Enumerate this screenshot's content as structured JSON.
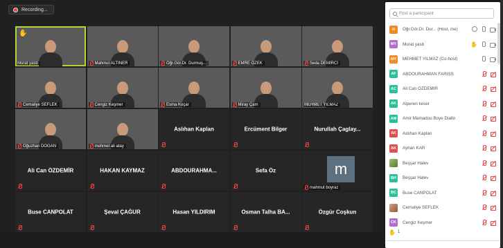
{
  "recording": {
    "label": "Recording..."
  },
  "gallery": {
    "tiles": [
      {
        "name": "Murat yasb",
        "kind": "video",
        "bg": "bg1",
        "hand": true,
        "muted": false,
        "active": true
      },
      {
        "name": "Mahmut ALTINER",
        "kind": "video",
        "bg": "bg2",
        "muted": true
      },
      {
        "name": "Öğr.Gör.Dr. Durmuş...",
        "kind": "video",
        "bg": "bg3",
        "muted": true
      },
      {
        "name": "EMRE ÖZEK",
        "kind": "video",
        "bg": "bg4",
        "muted": true
      },
      {
        "name": "Seda DEMİRCİ",
        "kind": "video",
        "bg": "bg5",
        "muted": true
      },
      {
        "name": "Cemaliye SEFLEK",
        "kind": "video",
        "bg": "bg6",
        "muted": true
      },
      {
        "name": "Cengiz Keşmer",
        "kind": "video",
        "bg": "bg7",
        "muted": true
      },
      {
        "name": "Esma Koçar",
        "kind": "video",
        "bg": "bg8",
        "muted": true
      },
      {
        "name": "Miray Çam",
        "kind": "video",
        "bg": "bg9",
        "muted": true
      },
      {
        "name": "MEHMET YILMAZ",
        "kind": "video",
        "bg": "bg10",
        "muted": false
      },
      {
        "name": "Oğuzhan DOĞAN",
        "kind": "video",
        "bg": "bg11",
        "muted": true
      },
      {
        "name": "mehmet ali atay",
        "kind": "video",
        "bg": "bg12",
        "muted": true
      },
      {
        "name": "Aslıhan Kaplan",
        "kind": "name",
        "muted": true
      },
      {
        "name": "Ercüment Bilger",
        "kind": "name",
        "muted": true
      },
      {
        "name": "Nurullah  Çaglay...",
        "kind": "name",
        "muted": true
      },
      {
        "name": "Ali Can ÖZDEMİR",
        "kind": "name",
        "muted": true
      },
      {
        "name": "HAKAN KAYMAZ",
        "kind": "name",
        "muted": true
      },
      {
        "name": "ABDOURAHMA...",
        "kind": "name",
        "muted": true
      },
      {
        "name": "Sefa Öz",
        "kind": "name",
        "muted": true
      },
      {
        "name": "mahmut boyraz",
        "kind": "avatar",
        "avatar_letter": "m",
        "muted": true
      },
      {
        "name": "Buse CANPOLAT",
        "kind": "name",
        "muted": true
      },
      {
        "name": "Şeval ÇAĞUR",
        "kind": "name",
        "muted": true
      },
      {
        "name": "Hasan YILDIRIM",
        "kind": "name",
        "muted": true
      },
      {
        "name": "Osman Talha BA...",
        "kind": "name",
        "muted": true
      },
      {
        "name": "Özgür Coşkun",
        "kind": "name",
        "muted": true
      }
    ]
  },
  "participants": {
    "search_placeholder": "Find a participant",
    "list": [
      {
        "initials": "O",
        "color": "#f08a24",
        "name": "Öğr.Gör.Dr. Dur...  (Host, me)",
        "icons": "host"
      },
      {
        "initials": "MY",
        "color": "#b06fd0",
        "name": "Murat yasb",
        "icons": "hand"
      },
      {
        "initials": "MY",
        "color": "#f08a24",
        "name": "MEHMET YILMAZ (Co-host)",
        "icons": "on"
      },
      {
        "initials": "AF",
        "color": "#2cbf9a",
        "name": "ABDOURAHMAN FARISS",
        "icons": "off"
      },
      {
        "initials": "AC",
        "color": "#2cbf9a",
        "name": "Ali Can ÖZDEMİR",
        "icons": "off"
      },
      {
        "initials": "AK",
        "color": "#2cbf9a",
        "name": "Alperen keser",
        "icons": "off"
      },
      {
        "initials": "AM",
        "color": "#2cbf9a",
        "name": "Amir Mamadou Boye Diallo",
        "icons": "off"
      },
      {
        "initials": "AK",
        "color": "#e05050",
        "name": "Aslıhan Kaplan",
        "icons": "off"
      },
      {
        "initials": "AK",
        "color": "#e05050",
        "name": "Ayhan KAR",
        "icons": "off"
      },
      {
        "initials": "",
        "color": "photo",
        "name": "Beşşar Halev",
        "icons": "off"
      },
      {
        "initials": "BH",
        "color": "#2cbf9a",
        "name": "Beşşar Halev",
        "icons": "off"
      },
      {
        "initials": "BC",
        "color": "#2cbf9a",
        "name": "Buse CANPOLAT",
        "icons": "off"
      },
      {
        "initials": "",
        "color": "photo2",
        "name": "Cemaliye SEFLEK",
        "icons": "off"
      },
      {
        "initials": "CK",
        "color": "#b06fd0",
        "name": "Cengiz Keşmer",
        "icons": "off"
      }
    ],
    "footer_count": "1"
  }
}
